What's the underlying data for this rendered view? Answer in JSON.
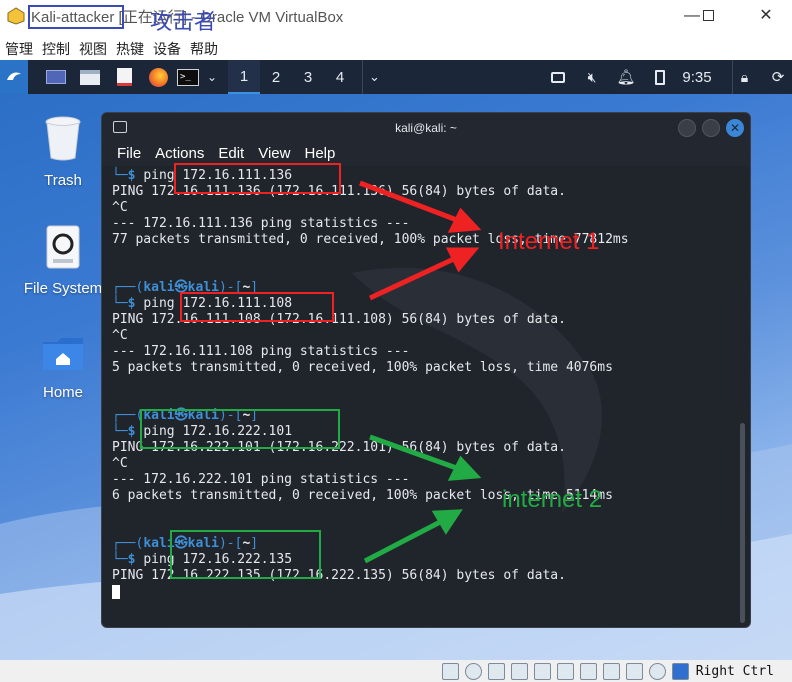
{
  "vbox": {
    "title": "Kali-attacker [正在运行] - Oracle VM VirtualBox",
    "title_highlight_annotation": "攻击者",
    "menu": [
      "管理",
      "控制",
      "视图",
      "热键",
      "设备",
      "帮助"
    ],
    "host_key": "Right Ctrl"
  },
  "panel": {
    "workspaces": [
      "1",
      "2",
      "3",
      "4"
    ],
    "active_workspace": "1",
    "clock": "9:35"
  },
  "desktop": {
    "icons": [
      {
        "label": "Trash",
        "icon": "trash-icon"
      },
      {
        "label": "File System",
        "icon": "drive-icon"
      },
      {
        "label": "Home",
        "icon": "home-folder-icon"
      }
    ]
  },
  "terminal": {
    "title": "kali@kali: ~",
    "menu": [
      "File",
      "Actions",
      "Edit",
      "View",
      "Help"
    ],
    "lines": [
      {
        "type": "cmd",
        "cmd": "ping 172.16.111.136"
      },
      {
        "type": "out",
        "text": "PING 172.16.111.136 (172.16.111.136) 56(84) bytes of data."
      },
      {
        "type": "out",
        "text": "^C"
      },
      {
        "type": "out",
        "text": "--- 172.16.111.136 ping statistics ---"
      },
      {
        "type": "out",
        "text": "77 packets transmitted, 0 received, 100% packet loss, time 77812ms"
      },
      {
        "type": "blank"
      },
      {
        "type": "blank"
      },
      {
        "type": "prompt",
        "user": "kali",
        "host": "kali",
        "dir": "~"
      },
      {
        "type": "cmd",
        "cmd": "ping 172.16.111.108"
      },
      {
        "type": "out",
        "text": "PING 172.16.111.108 (172.16.111.108) 56(84) bytes of data."
      },
      {
        "type": "out",
        "text": "^C"
      },
      {
        "type": "out",
        "text": "--- 172.16.111.108 ping statistics ---"
      },
      {
        "type": "out",
        "text": "5 packets transmitted, 0 received, 100% packet loss, time 4076ms"
      },
      {
        "type": "blank"
      },
      {
        "type": "blank"
      },
      {
        "type": "prompt",
        "user": "kali",
        "host": "kali",
        "dir": "~"
      },
      {
        "type": "cmd",
        "cmd": "ping 172.16.222.101"
      },
      {
        "type": "out",
        "text": "PING 172.16.222.101 (172.16.222.101) 56(84) bytes of data."
      },
      {
        "type": "out",
        "text": "^C"
      },
      {
        "type": "out",
        "text": "--- 172.16.222.101 ping statistics ---"
      },
      {
        "type": "out",
        "text": "6 packets transmitted, 0 received, 100% packet loss, time 5114ms"
      },
      {
        "type": "blank"
      },
      {
        "type": "blank"
      },
      {
        "type": "prompt",
        "user": "kali",
        "host": "kali",
        "dir": "~"
      },
      {
        "type": "cmd",
        "cmd": "ping 172.16.222.135"
      },
      {
        "type": "out",
        "text": "PING 172.16.222.135 (172.16.222.135) 56(84) bytes of data."
      },
      {
        "type": "cursor"
      }
    ]
  },
  "annotations": {
    "internet1": {
      "label": "Internet 1",
      "color": "#ee2222"
    },
    "internet2": {
      "label": "internet 2",
      "color": "#22aa44"
    }
  }
}
